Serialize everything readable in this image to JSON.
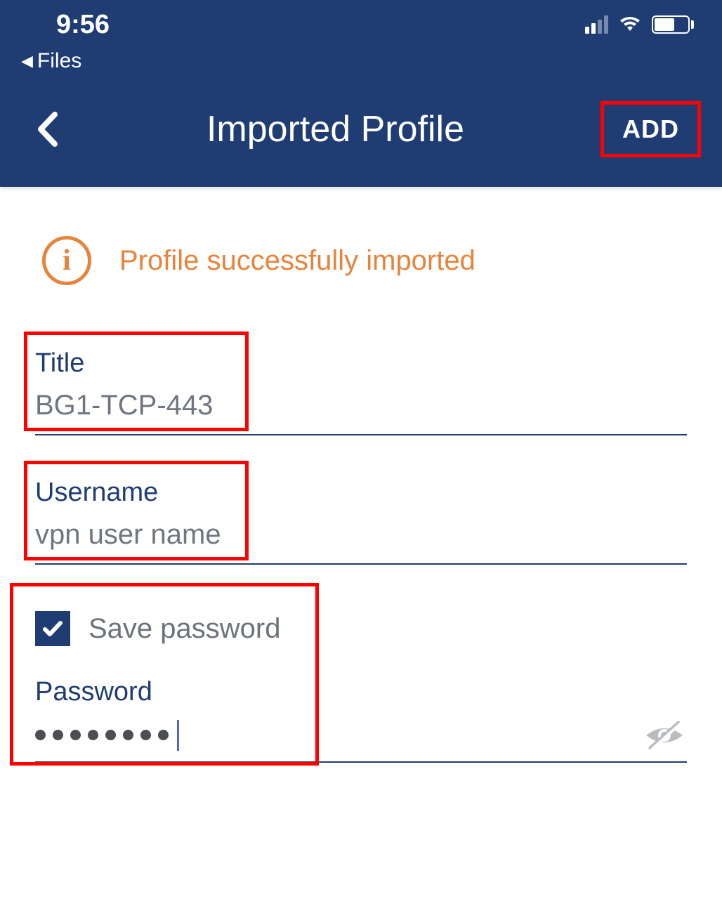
{
  "status": {
    "time": "9:56",
    "back_app": "Files"
  },
  "nav": {
    "title": "Imported Profile",
    "add_button": "ADD"
  },
  "info": {
    "message": "Profile successfully imported"
  },
  "fields": {
    "title": {
      "label": "Title",
      "value": "BG1-TCP-443"
    },
    "username": {
      "label": "Username",
      "value": "vpn user name"
    },
    "save_password": {
      "label": "Save password",
      "checked": true
    },
    "password": {
      "label": "Password",
      "dots_count": 8
    }
  },
  "colors": {
    "primary": "#1f3d73",
    "accent": "#e8833a",
    "highlight": "#ff0000"
  }
}
